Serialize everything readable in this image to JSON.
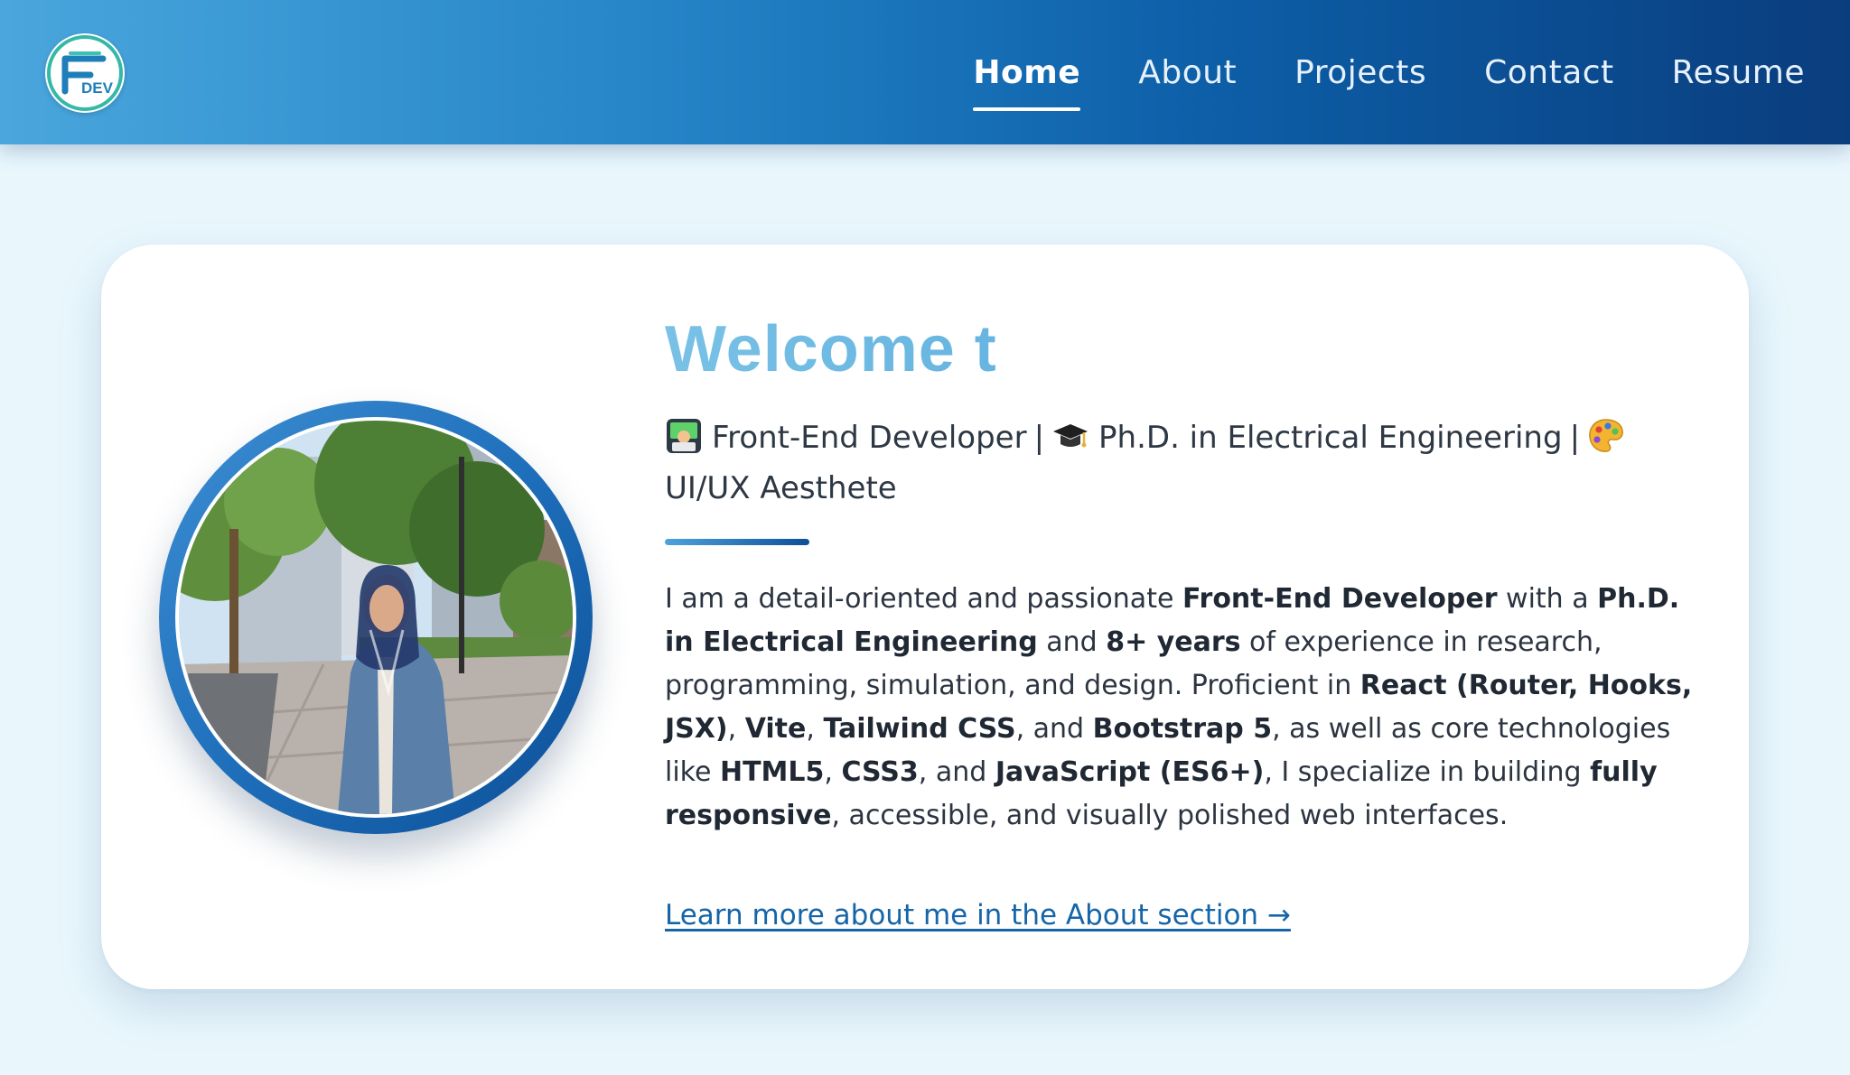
{
  "nav": {
    "logo_text": "DEV",
    "links": [
      {
        "label": "Home",
        "active": true
      },
      {
        "label": "About",
        "active": false
      },
      {
        "label": "Projects",
        "active": false
      },
      {
        "label": "Contact",
        "active": false
      },
      {
        "label": "Resume",
        "active": false
      }
    ]
  },
  "hero": {
    "headline": "Welcome t",
    "subtitle": {
      "role1": "Front-End Developer",
      "role1_icon": "technologist-emoji",
      "role2": "Ph.D. in Electrical Engineering",
      "role2_icon": "graduation-cap-emoji",
      "role3": "UI/UX Aesthete",
      "role3_icon": "artist-palette-emoji",
      "separator": "|"
    },
    "bio": {
      "p1": "I am a detail-oriented and passionate ",
      "b1": "Front-End Developer",
      "p2": " with a ",
      "b2": "Ph.D. in Electrical Engineering",
      "p3": " and ",
      "b3": "8+ years",
      "p4": " of experience in research, programming, simulation, and design. Proficient in ",
      "b4": "React (Router, Hooks, JSX)",
      "p5": ", ",
      "b5": "Vite",
      "p6": ", ",
      "b6": "Tailwind CSS",
      "p7": ", and ",
      "b7": "Bootstrap 5",
      "p8": ", as well as core technologies like ",
      "b8": "HTML5",
      "p9": ", ",
      "b9": "CSS3",
      "p10": ", and ",
      "b10": "JavaScript (ES6+)",
      "p11": ", I specialize in building ",
      "b11": "fully responsive",
      "p12": ", accessible, and visually polished web interfaces."
    },
    "learn_more": "Learn more about me in the About section →"
  },
  "colors": {
    "nav_gradient_start": "#4aa6dc",
    "nav_gradient_end": "#0a3d7e",
    "page_background": "#e9f7fd",
    "headline": "#5aaedc",
    "link": "#1565a8"
  }
}
